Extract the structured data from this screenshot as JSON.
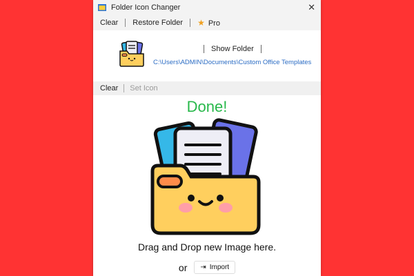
{
  "window": {
    "title": "Folder Icon Changer",
    "close_glyph": "✕"
  },
  "toolbar": {
    "clear": "Clear",
    "restore": "Restore Folder",
    "pro": "Pro",
    "star_icon": "★"
  },
  "info": {
    "show_folder": "Show Folder",
    "path": "C:\\Users\\ADMIN\\Documents\\Custom Office Templates"
  },
  "actionbar": {
    "clear": "Clear",
    "set_icon": "Set Icon"
  },
  "drop": {
    "status": "Done!",
    "instruction": "Drag and Drop new Image here.",
    "or": "or",
    "import": "Import",
    "import_icon": "⇥"
  },
  "colors": {
    "background": "#ff3333",
    "done": "#27b84a",
    "link": "#2b6cc4",
    "star": "#f0a020"
  }
}
